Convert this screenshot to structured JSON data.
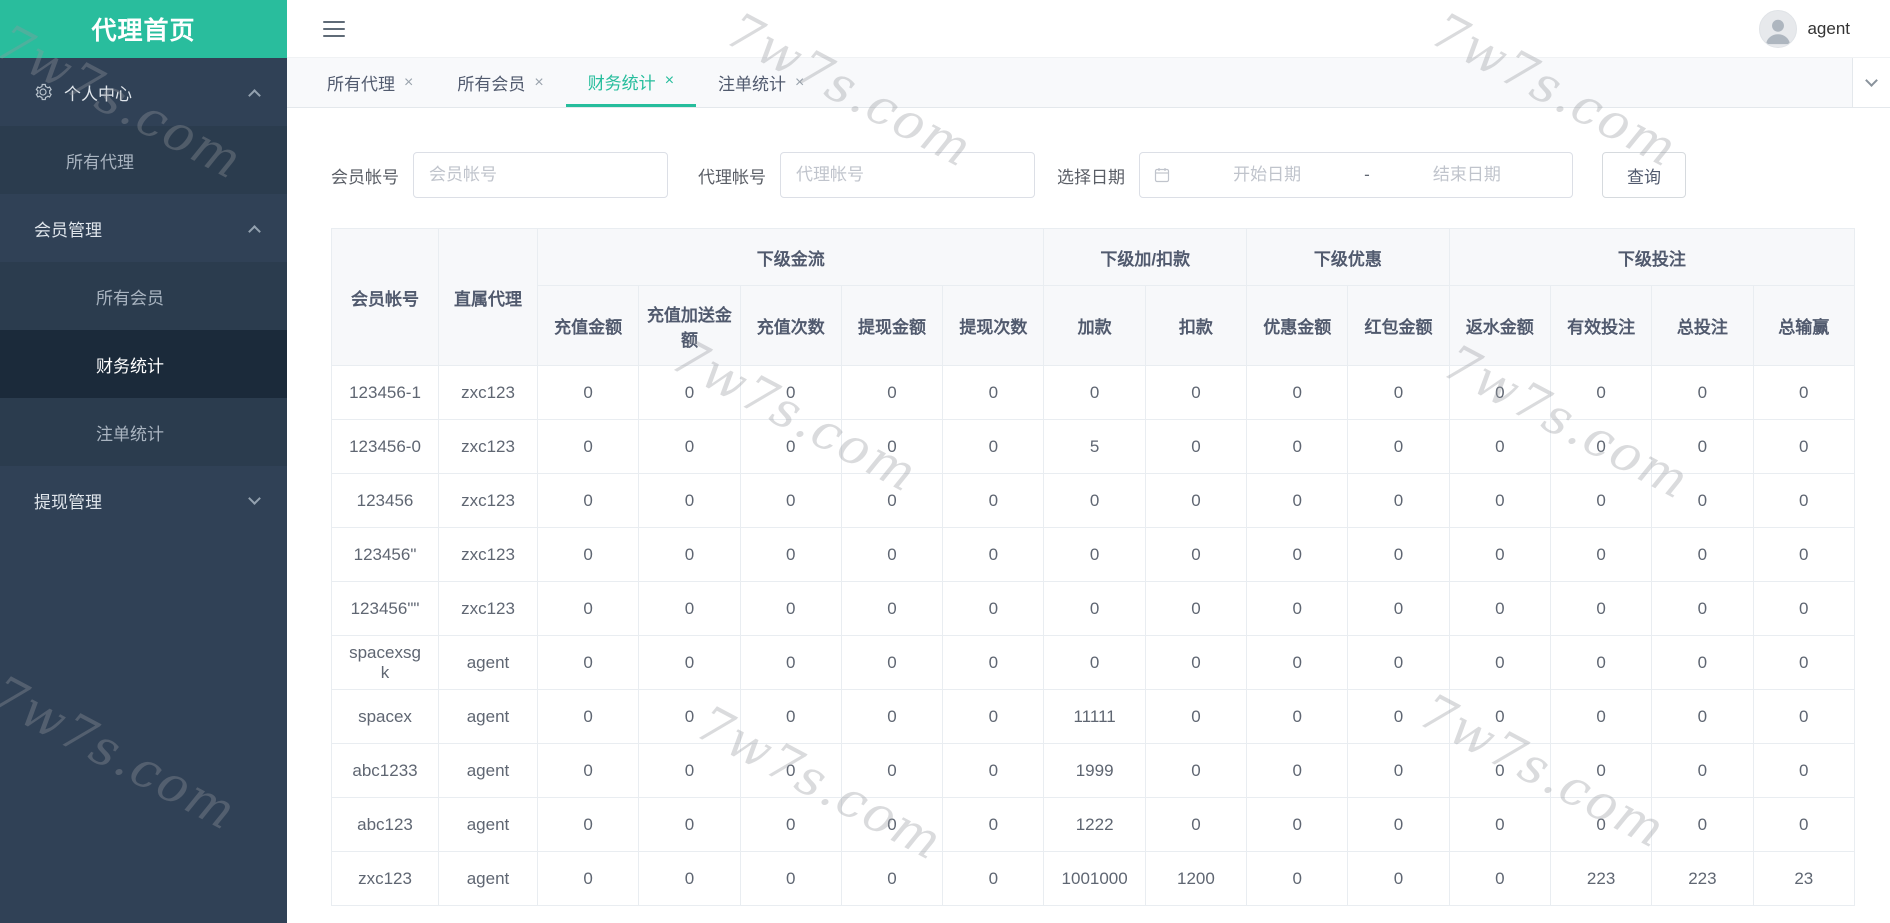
{
  "colors": {
    "accent": "#26bd9c",
    "sidebar_bg": "#304156",
    "sidebar_active_bg": "#1b2a3a",
    "title_bg": "#29bd9d",
    "table_header_bg": "#f7f8fa"
  },
  "icons": {
    "gear": "⚙",
    "hamburger": "☰",
    "calendar": "📅",
    "close": "×",
    "chevron_down": "∨",
    "chevron_up": "∧"
  },
  "sidebar": {
    "title": "代理首页",
    "items": [
      {
        "label": "个人中心",
        "type": "parent",
        "icon": "gear-icon",
        "state": "expanded"
      },
      {
        "label": "所有代理",
        "type": "child"
      },
      {
        "label": "会员管理",
        "type": "parent",
        "state": "expanded"
      },
      {
        "label": "所有会员",
        "type": "child"
      },
      {
        "label": "财务统计",
        "type": "child",
        "active": true
      },
      {
        "label": "注单统计",
        "type": "child"
      },
      {
        "label": "提现管理",
        "type": "parent",
        "state": "collapsed"
      }
    ]
  },
  "topbar": {
    "username": "agent"
  },
  "tabs": {
    "active_index": 2,
    "items": [
      {
        "label": "所有代理"
      },
      {
        "label": "所有会员"
      },
      {
        "label": "财务统计",
        "active": true
      },
      {
        "label": "注单统计"
      }
    ]
  },
  "filters": {
    "member_label": "会员帐号",
    "member_placeholder": "会员帐号",
    "agent_label": "代理帐号",
    "agent_placeholder": "代理帐号",
    "date_label": "选择日期",
    "date_start_placeholder": "开始日期",
    "date_separator": "-",
    "date_end_placeholder": "结束日期",
    "search_button": "查询"
  },
  "table": {
    "groups": [
      "下级金流",
      "下级加/扣款",
      "下级优惠",
      "下级投注"
    ],
    "columns": [
      "会员帐号",
      "直属代理",
      "充值金额",
      "充值加送金额",
      "充值次数",
      "提现金额",
      "提现次数",
      "加款",
      "扣款",
      "优惠金额",
      "红包金额",
      "返水金额",
      "有效投注",
      "总投注",
      "总输赢"
    ],
    "rows": [
      [
        "123456-1",
        "zxc123",
        "0",
        "0",
        "0",
        "0",
        "0",
        "0",
        "0",
        "0",
        "0",
        "0",
        "0",
        "0",
        "0"
      ],
      [
        "123456-0",
        "zxc123",
        "0",
        "0",
        "0",
        "0",
        "0",
        "5",
        "0",
        "0",
        "0",
        "0",
        "0",
        "0",
        "0"
      ],
      [
        "123456",
        "zxc123",
        "0",
        "0",
        "0",
        "0",
        "0",
        "0",
        "0",
        "0",
        "0",
        "0",
        "0",
        "0",
        "0"
      ],
      [
        "123456\"",
        "zxc123",
        "0",
        "0",
        "0",
        "0",
        "0",
        "0",
        "0",
        "0",
        "0",
        "0",
        "0",
        "0",
        "0"
      ],
      [
        "123456\"\"",
        "zxc123",
        "0",
        "0",
        "0",
        "0",
        "0",
        "0",
        "0",
        "0",
        "0",
        "0",
        "0",
        "0",
        "0"
      ],
      [
        "spacexsgk",
        "agent",
        "0",
        "0",
        "0",
        "0",
        "0",
        "0",
        "0",
        "0",
        "0",
        "0",
        "0",
        "0",
        "0"
      ],
      [
        "spacex",
        "agent",
        "0",
        "0",
        "0",
        "0",
        "0",
        "11111",
        "0",
        "0",
        "0",
        "0",
        "0",
        "0",
        "0"
      ],
      [
        "abc1233",
        "agent",
        "0",
        "0",
        "0",
        "0",
        "0",
        "1999",
        "0",
        "0",
        "0",
        "0",
        "0",
        "0",
        "0"
      ],
      [
        "abc123",
        "agent",
        "0",
        "0",
        "0",
        "0",
        "0",
        "1222",
        "0",
        "0",
        "0",
        "0",
        "0",
        "0",
        "0"
      ],
      [
        "zxc123",
        "agent",
        "0",
        "0",
        "0",
        "0",
        "0",
        "1001000",
        "1200",
        "0",
        "0",
        "0",
        "223",
        "223",
        "23"
      ]
    ]
  },
  "watermark": {
    "text": "7w7s.com"
  }
}
